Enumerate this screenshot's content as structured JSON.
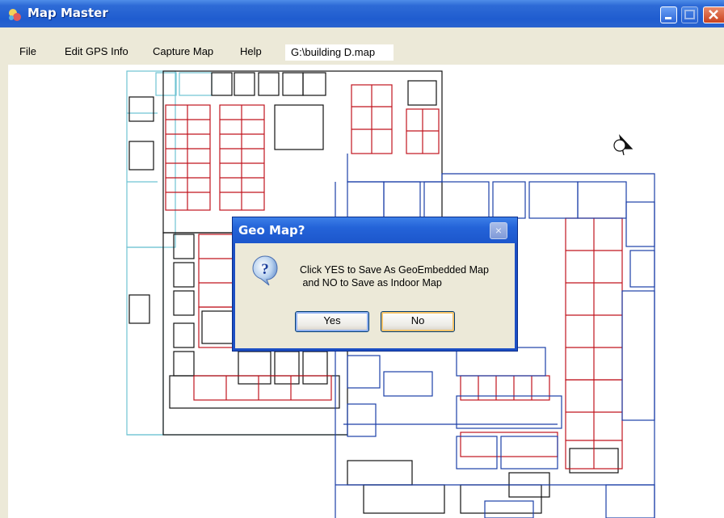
{
  "window": {
    "title": "Map Master",
    "icon": "map-app-icon"
  },
  "menu": {
    "items": [
      "File",
      "Edit GPS Info",
      "Capture Map",
      "Help"
    ],
    "current_file": "G:\\building D.map"
  },
  "dialog": {
    "title": "Geo Map?",
    "message": "Click YES to Save As GeoEmbedded Map\n and NO to Save as Indoor Map",
    "yes_label": "Yes",
    "no_label": "No",
    "icon": "question-icon",
    "close_glyph": "×"
  },
  "colors": {
    "titlebar": "#1f5ccf",
    "wall_black": "#111111",
    "wall_red": "#c0141e",
    "wall_blue": "#1c3fa8",
    "wall_cyan": "#6fc3d3"
  }
}
